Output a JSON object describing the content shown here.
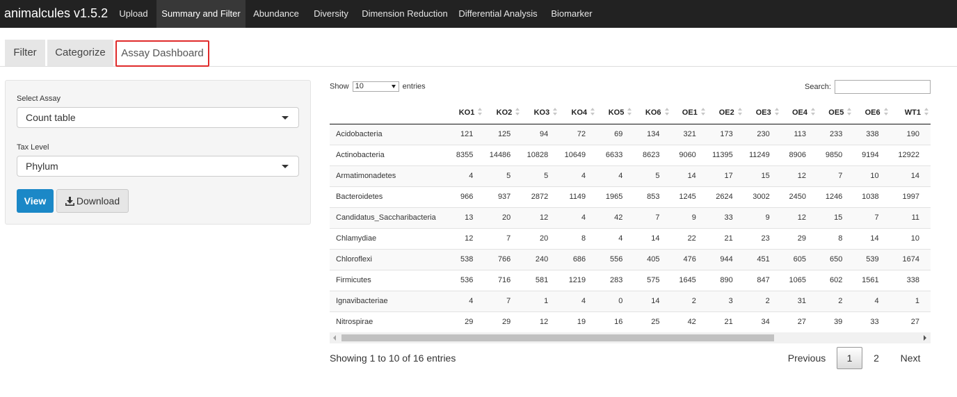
{
  "app": {
    "title": "animalcules v1.5.2"
  },
  "nav": {
    "items": [
      {
        "label": "Upload"
      },
      {
        "label": "Summary and Filter"
      },
      {
        "label": "Abundance"
      },
      {
        "label": "Diversity"
      },
      {
        "label": "Dimension Reduction"
      },
      {
        "label": "Differential Analysis"
      },
      {
        "label": "Biomarker"
      }
    ],
    "active": "Summary and Filter"
  },
  "tabs": {
    "items": [
      {
        "label": "Filter"
      },
      {
        "label": "Categorize"
      },
      {
        "label": "Assay Dashboard"
      }
    ],
    "active": "Assay Dashboard",
    "highlight_color": "#e02a2a"
  },
  "panel": {
    "assay_label": "Select Assay",
    "assay_value": "Count table",
    "tax_label": "Tax Level",
    "tax_value": "Phylum",
    "view_label": "View",
    "download_label": "Download",
    "accent": "#1b88c7"
  },
  "table": {
    "show_label": "Show",
    "entries_value": "10",
    "entries_label": "entries",
    "search_label": "Search:",
    "search_value": "",
    "columns": [
      "",
      "KO1",
      "KO2",
      "KO3",
      "KO4",
      "KO5",
      "KO6",
      "OE1",
      "OE2",
      "OE3",
      "OE4",
      "OE5",
      "OE6",
      "WT1"
    ],
    "rows": [
      [
        "Acidobacteria",
        "121",
        "125",
        "94",
        "72",
        "69",
        "134",
        "321",
        "173",
        "230",
        "113",
        "233",
        "338",
        "190"
      ],
      [
        "Actinobacteria",
        "8355",
        "14486",
        "10828",
        "10649",
        "6633",
        "8623",
        "9060",
        "11395",
        "11249",
        "8906",
        "9850",
        "9194",
        "12922"
      ],
      [
        "Armatimonadetes",
        "4",
        "5",
        "5",
        "4",
        "4",
        "5",
        "14",
        "17",
        "15",
        "12",
        "7",
        "10",
        "14"
      ],
      [
        "Bacteroidetes",
        "966",
        "937",
        "2872",
        "1149",
        "1965",
        "853",
        "1245",
        "2624",
        "3002",
        "2450",
        "1246",
        "1038",
        "1997"
      ],
      [
        "Candidatus_Saccharibacteria",
        "13",
        "20",
        "12",
        "4",
        "42",
        "7",
        "9",
        "33",
        "9",
        "12",
        "15",
        "7",
        "11"
      ],
      [
        "Chlamydiae",
        "12",
        "7",
        "20",
        "8",
        "4",
        "14",
        "22",
        "21",
        "23",
        "29",
        "8",
        "14",
        "10"
      ],
      [
        "Chloroflexi",
        "538",
        "766",
        "240",
        "686",
        "556",
        "405",
        "476",
        "944",
        "451",
        "605",
        "650",
        "539",
        "1674"
      ],
      [
        "Firmicutes",
        "536",
        "716",
        "581",
        "1219",
        "283",
        "575",
        "1645",
        "890",
        "847",
        "1065",
        "602",
        "1561",
        "338"
      ],
      [
        "Ignavibacteriae",
        "4",
        "7",
        "1",
        "4",
        "0",
        "14",
        "2",
        "3",
        "2",
        "31",
        "2",
        "4",
        "1"
      ],
      [
        "Nitrospirae",
        "29",
        "29",
        "12",
        "19",
        "16",
        "25",
        "42",
        "21",
        "34",
        "27",
        "39",
        "33",
        "27"
      ]
    ]
  },
  "pagination": {
    "info": "Showing 1 to 10 of 16 entries",
    "previous": "Previous",
    "pages": [
      "1",
      "2"
    ],
    "current": "1",
    "next": "Next"
  }
}
